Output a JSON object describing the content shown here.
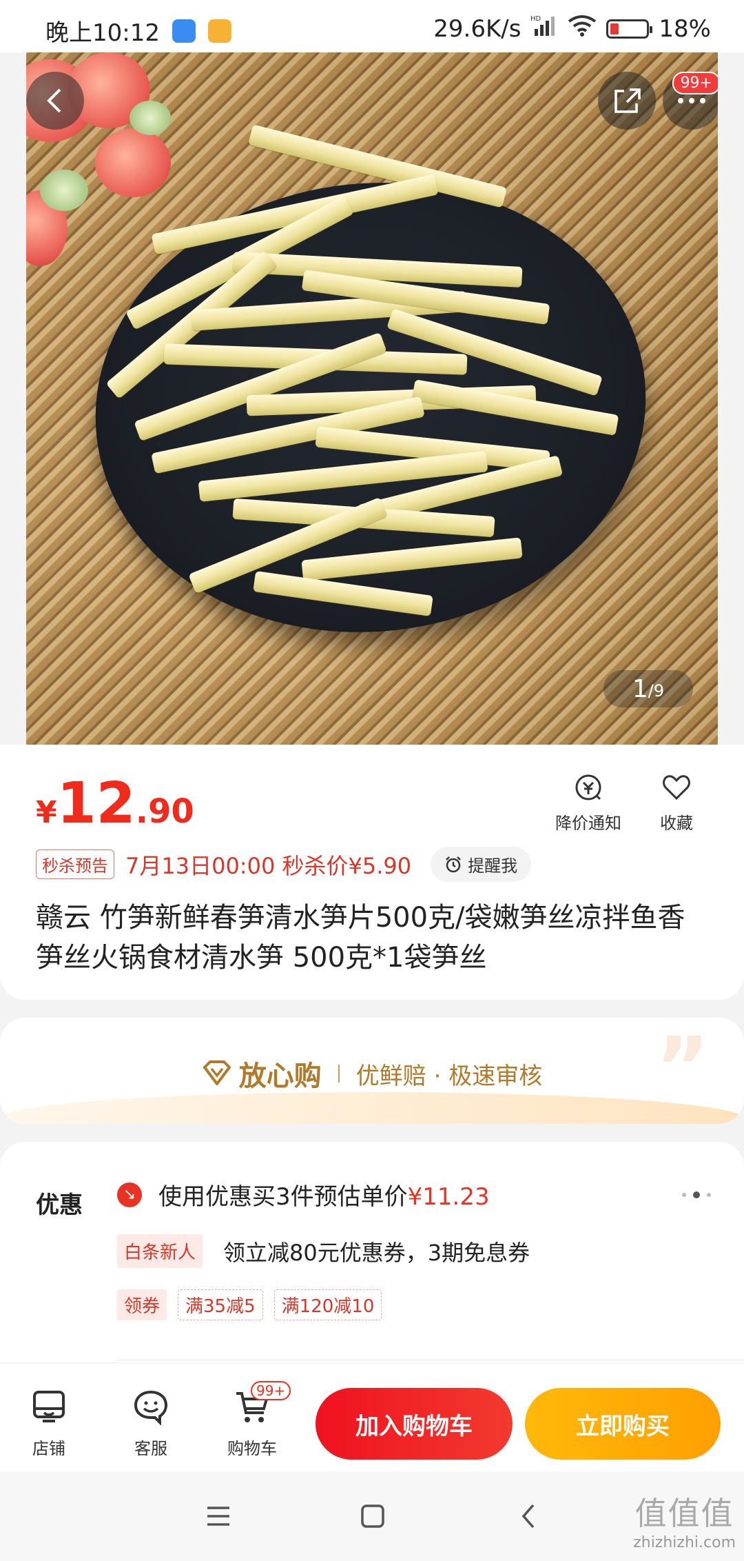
{
  "status_bar": {
    "time": "晚上10:12",
    "network_speed": "29.6K/s",
    "network_type": "HD",
    "battery": "18%",
    "battery_color": "#e53935"
  },
  "gallery": {
    "current": "1",
    "total": "/9",
    "more_badge": "99+"
  },
  "price": {
    "currency": "¥",
    "integer": "12",
    "decimal": ".90",
    "color": "#f02b1c"
  },
  "actions": {
    "price_alert": "降价通知",
    "favorite": "收藏"
  },
  "flash_sale": {
    "tag": "秒杀预告",
    "text": "7月13日00:00 秒杀价¥5.90",
    "remind": "提醒我"
  },
  "product": {
    "title": "赣云 竹笋新鲜春笋清水笋片500克/袋嫩笋丝凉拌鱼香笋丝火锅食材清水笋 500克*1袋笋丝"
  },
  "assurance": {
    "brand": "放心购",
    "desc": "优鲜赔 · 极速审核"
  },
  "promotions": {
    "label": "优惠",
    "line1_text": "使用优惠买3件预估单价",
    "line1_price": "¥11.23",
    "baitiao_tag": "白条新人",
    "baitiao_text": "领立减80元优惠券，3期免息券",
    "coupon_tag": "领券",
    "coupons": [
      "满35减5",
      "满120减10"
    ]
  },
  "bottom_bar": {
    "shop": "店铺",
    "service": "客服",
    "cart": "购物车",
    "cart_badge": "99+",
    "add_to_cart": "加入购物车",
    "buy_now": "立即购买"
  },
  "watermark": {
    "big": "值值值",
    "small": "zhizhizhi.com"
  }
}
